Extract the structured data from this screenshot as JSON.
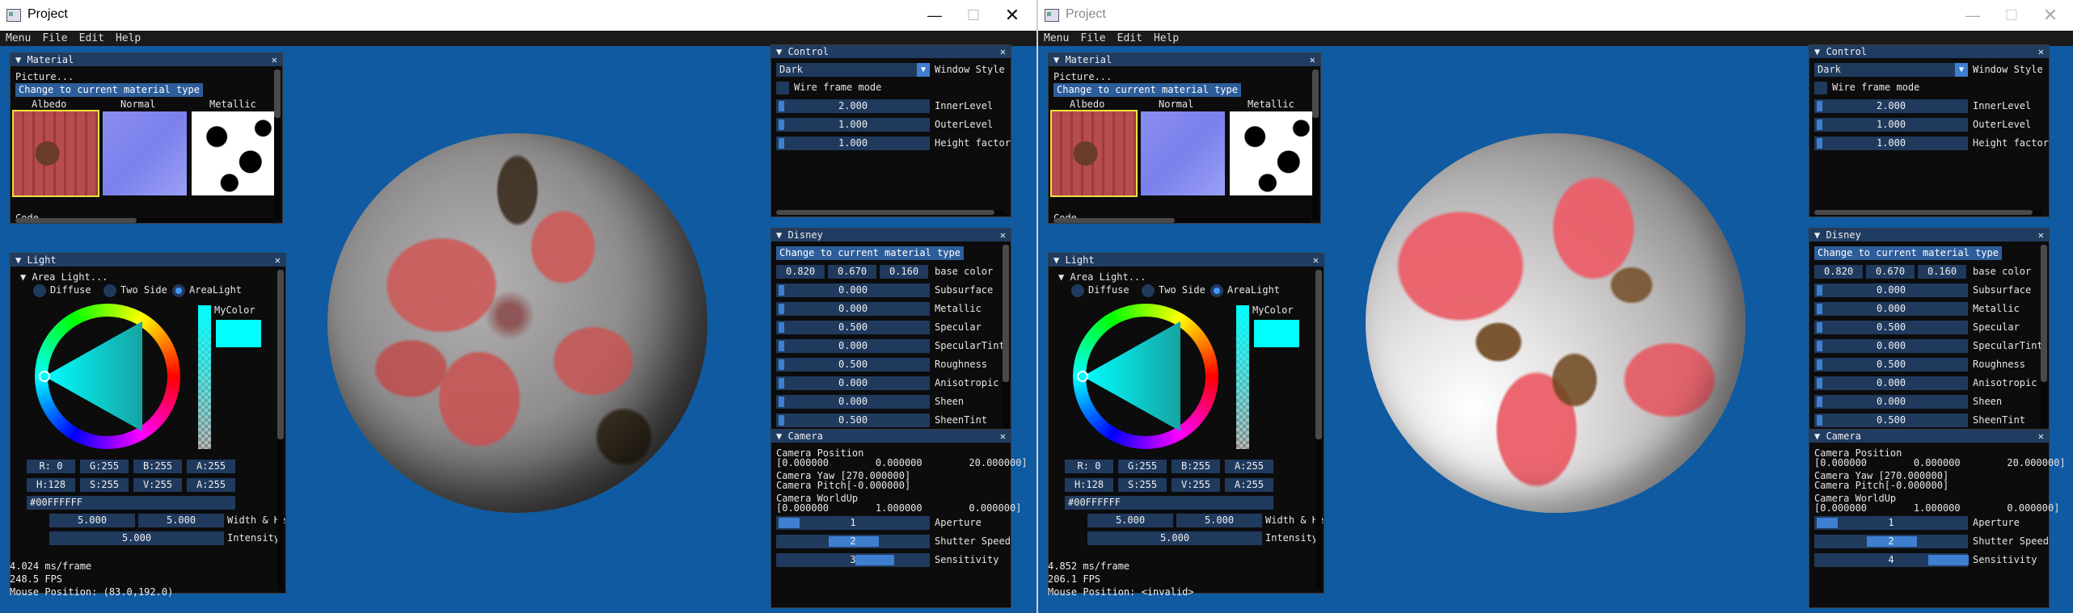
{
  "windows": [
    {
      "id": "left",
      "title": "Project",
      "title_dimmed": false,
      "menu": [
        "Menu",
        "File",
        "Edit",
        "Help"
      ],
      "hud": {
        "frame_ms": "4.024 ms/frame",
        "fps": "248.5 FPS",
        "mouse": "Mouse Position: (83.0,192.0)"
      }
    },
    {
      "id": "right",
      "title": "Project",
      "title_dimmed": true,
      "menu": [
        "Menu",
        "File",
        "Edit",
        "Help"
      ],
      "hud": {
        "frame_ms": "4.852 ms/frame",
        "fps": "206.1 FPS",
        "mouse": "Mouse Position: <invalid>"
      }
    }
  ],
  "material_panel": {
    "title": "Material",
    "picture_label": "Picture...",
    "change_button": "Change to current material type",
    "textures": [
      {
        "label": "Albedo",
        "selected": true
      },
      {
        "label": "Normal",
        "selected": false
      },
      {
        "label": "Metallic",
        "selected": false
      }
    ],
    "code_label": "Code..."
  },
  "light_panel": {
    "title": "Light",
    "area_light_header": "Area Light...",
    "modes": [
      {
        "label": "Diffuse",
        "selected": false
      },
      {
        "label": "Two Side",
        "selected": false
      },
      {
        "label": "AreaLight",
        "selected": true
      }
    ],
    "color_label": "MyColor",
    "swatch_color": "#00ffff",
    "rgba": [
      "R:  0",
      "G:255",
      "B:255",
      "A:255"
    ],
    "hsva": [
      "H:128",
      "S:255",
      "V:255",
      "A:255"
    ],
    "hex": "#00FFFFFF",
    "width_values": [
      "5.000",
      "5.000"
    ],
    "width_label": "Width & He",
    "intensity_value": "5.000",
    "intensity_label": "Intensity"
  },
  "control_panel": {
    "title": "Control",
    "window_style_value": "Dark",
    "window_style_label": "Window Style",
    "wireframe_label": "Wire frame mode",
    "wireframe_checked": false,
    "sliders": [
      {
        "value": "2.000",
        "label": "InnerLevel"
      },
      {
        "value": "1.000",
        "label": "OuterLevel"
      },
      {
        "value": "1.000",
        "label": "Height factor"
      }
    ]
  },
  "disney_panel": {
    "title": "Disney",
    "change_button": "Change to current material type",
    "base_color_values": [
      "0.820",
      "0.670",
      "0.160"
    ],
    "base_color_label": "base color",
    "params": [
      {
        "value": "0.000",
        "label": "Subsurface"
      },
      {
        "value": "0.000",
        "label": "Metallic"
      },
      {
        "value": "0.500",
        "label": "Specular"
      },
      {
        "value": "0.000",
        "label": "SpecularTint"
      },
      {
        "value": "0.500",
        "label": "Roughness"
      },
      {
        "value": "0.000",
        "label": "Anisotropic"
      },
      {
        "value": "0.000",
        "label": "Sheen"
      },
      {
        "value": "0.500",
        "label": "SheenTint"
      }
    ]
  },
  "camera_panel": {
    "title": "Camera",
    "position_label": "Camera Position",
    "position_values": "[0.000000        0.000000        20.000000]",
    "yaw": "Camera Yaw [270.000000]",
    "pitch": "Camera Pitch[-0.000000]",
    "worldup_label": "Camera WorldUp",
    "worldup_values": "[0.000000        1.000000        0.000000]",
    "sliders": [
      {
        "value": "1",
        "label": "Aperture"
      },
      {
        "value": "2",
        "label": "Shutter Speed"
      },
      {
        "value": "3",
        "label": "Sensitivity"
      }
    ],
    "right_sensitivity_value": "4"
  },
  "colors": {
    "background": "#0f5aa0",
    "panel_bg": "#0c0c0c",
    "header": "#203c62",
    "accent": "#4296fa"
  }
}
